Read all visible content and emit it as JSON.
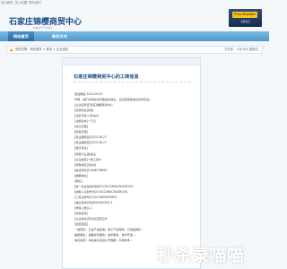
{
  "topbar": {
    "links": [
      "设为首页",
      "加入收藏",
      "联系我们"
    ]
  },
  "header": {
    "site_name": "石家庄锦樱商贸中心",
    "site_url": "www.***.com",
    "banner_badge": "Free Member",
    "banner_sub": "免费会员"
  },
  "nav": {
    "items": [
      "网站首页",
      "联系方式"
    ]
  },
  "breadcrumb": {
    "text": "您的位置：网站首页 > 首页 > 企业信息",
    "date": "今天是： 9月26日 星期五"
  },
  "article": {
    "title": "石家庄锦樱商贸中心的工商信息",
    "lines": [
      "源自网络 2024-09-03",
      "声明：我们为网站访问者提供信息，请注意鉴别信息的真实性。",
      "[企业名称]石家庄锦樱商贸中心",
      "[经营状态]存续",
      "[法定代表人]刘文杰",
      "[注册资本]一万元",
      "[成立日期]",
      "[核准日期]",
      "[营业期限自]2023-08-27",
      "[营业期限至]2023-08-27",
      "[登记机关]",
      "[所属行业]批发业",
      "[企业类型]个体工商户",
      "[所属地区]河北省",
      "[电话号码]13406796850",
      "[邮箱地址]",
      "[网址]",
      "[统一社会信用代码]92130124MACN4GRG0Q",
      "[纳税人识别号]92130124MACN4GRG0Q",
      "[工商注册号]130124600678400",
      "[组织机构代码]MACN4GRG-3",
      "[参保人数]1人",
      "[曾用名称]",
      "[企业地址]河北省石家庄市",
      "[经营范围]",
      "一般项目：五金产品批发；电子产品销售；日用品销售…",
      "抽奖销售；发展资讯服务；技术服务、技术开发…",
      "信息来源：本站信息来自公开数据，仅供参考…"
    ]
  },
  "watermark": {
    "text": "秒杀录喵喵",
    "color": "#ffffff"
  },
  "colors": {
    "nav": "#5aa3d6",
    "title": "#1c4f86",
    "badge": "#f6c31e"
  }
}
